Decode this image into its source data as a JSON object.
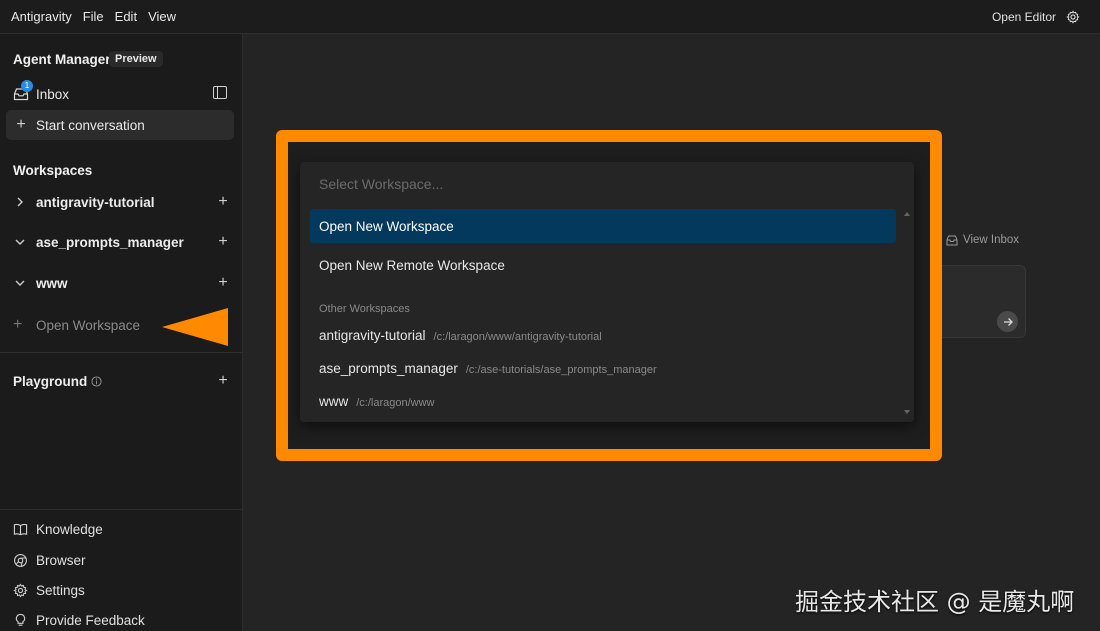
{
  "menubar": {
    "app_name": "Antigravity",
    "file": "File",
    "edit": "Edit",
    "view": "View",
    "open_editor": "Open Editor",
    "settings_icon": "gear-icon"
  },
  "sidebar": {
    "title": "Agent Manager",
    "preview_badge": "Preview",
    "inbox_label": "Inbox",
    "inbox_count": "1",
    "start_conversation": "Start conversation",
    "workspaces_heading": "Workspaces",
    "workspaces": [
      {
        "label": "antigravity-tutorial",
        "expanded": false
      },
      {
        "label": "ase_prompts_manager",
        "expanded": true
      },
      {
        "label": "www",
        "expanded": true
      }
    ],
    "open_workspace": "Open Workspace",
    "playground": "Playground",
    "bottom": {
      "knowledge": "Knowledge",
      "browser": "Browser",
      "settings": "Settings",
      "feedback": "Provide Feedback"
    }
  },
  "main": {
    "view_inbox": "View Inbox"
  },
  "picker": {
    "placeholder": "Select Workspace...",
    "items": [
      "Open New Workspace",
      "Open New Remote Workspace"
    ],
    "section_label": "Other Workspaces",
    "workspaces": [
      {
        "name": "antigravity-tutorial",
        "path": "/c:/laragon/www/antigravity-tutorial"
      },
      {
        "name": "ase_prompts_manager",
        "path": "/c:/ase-tutorials/ase_prompts_manager"
      },
      {
        "name": "www",
        "path": "/c:/laragon/www"
      }
    ]
  },
  "colors": {
    "accent_highlight": "#ff8a00",
    "selected_item": "#04395e",
    "badge": "#2b8be0"
  },
  "watermark": "掘金技术社区 @ 是魔丸啊"
}
